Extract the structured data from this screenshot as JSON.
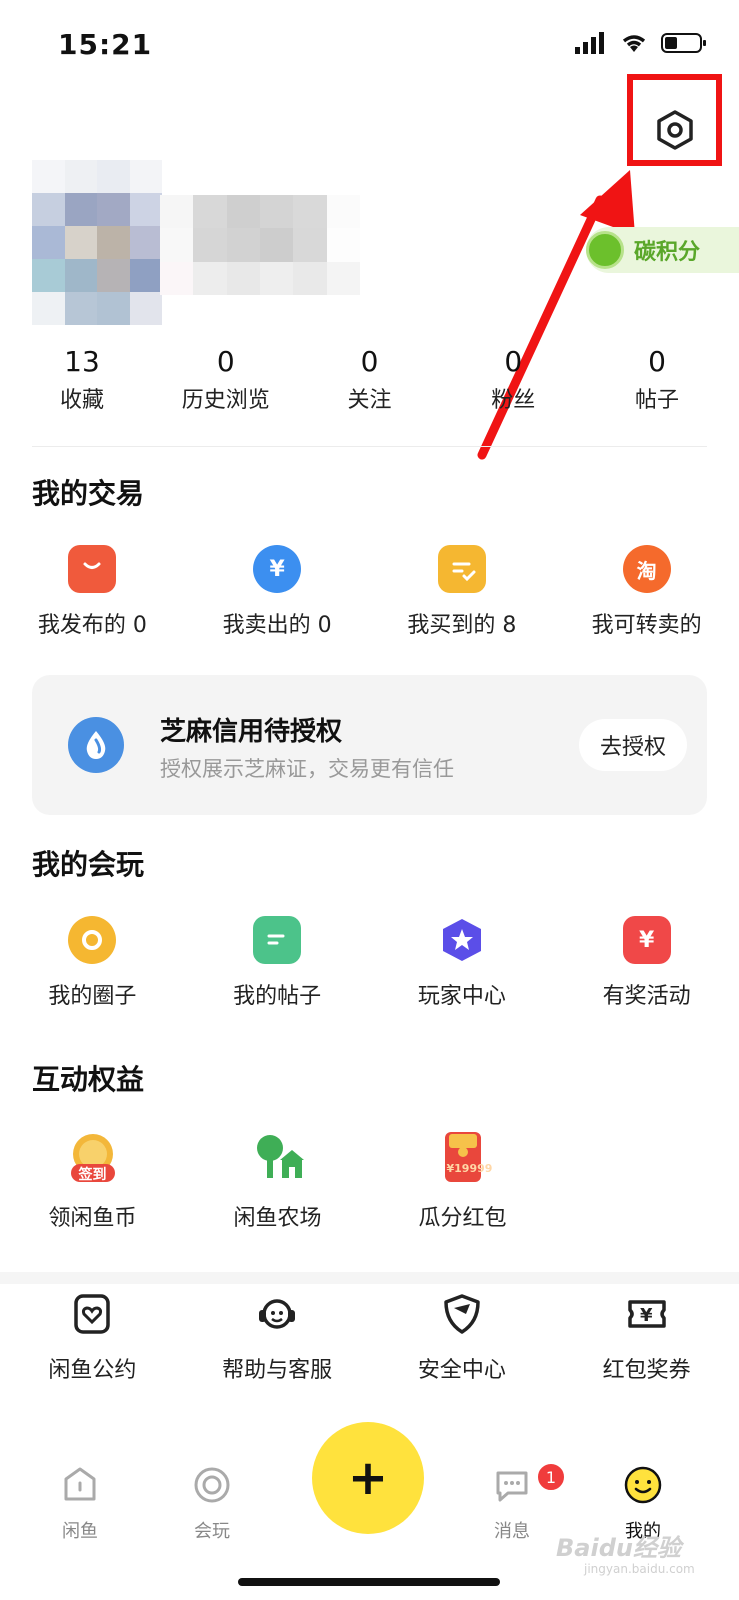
{
  "status_bar": {
    "time": "15:21"
  },
  "profile": {
    "carbon_label": "碳积分"
  },
  "stats": [
    {
      "value": "13",
      "label": "收藏"
    },
    {
      "value": "0",
      "label": "历史浏览"
    },
    {
      "value": "0",
      "label": "关注"
    },
    {
      "value": "0",
      "label": "粉丝"
    },
    {
      "value": "0",
      "label": "帖子"
    }
  ],
  "trade": {
    "title": "我的交易",
    "items": [
      {
        "label": "我发布的 0",
        "icon": "shopping-bag-icon"
      },
      {
        "label": "我卖出的 0",
        "icon": "yen-circle-icon"
      },
      {
        "label": "我买到的 8",
        "icon": "order-check-icon"
      },
      {
        "label": "我可转卖的",
        "icon": "taobao-icon",
        "glyph": "淘"
      }
    ]
  },
  "zhima": {
    "title": "芝麻信用待授权",
    "subtitle": "授权展示芝麻证，交易更有信任",
    "button": "去授权"
  },
  "play": {
    "title": "我的会玩",
    "items": [
      {
        "label": "我的圈子",
        "icon": "circle-icon"
      },
      {
        "label": "我的帖子",
        "icon": "post-icon"
      },
      {
        "label": "玩家中心",
        "icon": "star-hexagon-icon"
      },
      {
        "label": "有奖活动",
        "icon": "prize-yen-icon"
      }
    ]
  },
  "rights": {
    "title": "互动权益",
    "items": [
      {
        "label": "领闲鱼币",
        "icon": "checkin-coin-icon",
        "badge": "签到"
      },
      {
        "label": "闲鱼农场",
        "icon": "farm-house-icon"
      },
      {
        "label": "瓜分红包",
        "icon": "red-packet-icon",
        "badge": "¥19999"
      }
    ]
  },
  "services": [
    {
      "label": "闲鱼公约",
      "icon": "heart-document-icon"
    },
    {
      "label": "帮助与客服",
      "icon": "headset-icon"
    },
    {
      "label": "安全中心",
      "icon": "shield-icon"
    },
    {
      "label": "红包奖券",
      "icon": "coupon-icon"
    }
  ],
  "tabbar": {
    "tabs": [
      {
        "label": "闲鱼",
        "icon": "home-icon"
      },
      {
        "label": "会玩",
        "icon": "play-circle-icon"
      },
      {
        "label": "消息",
        "icon": "message-icon"
      },
      {
        "label": "我的",
        "icon": "smile-icon"
      }
    ],
    "publish_label": "+",
    "message_badge": "1"
  },
  "watermark": {
    "text": "Baidu经验",
    "sub": "jingyan.baidu.com"
  },
  "colors": {
    "accent_yellow": "#ffe23d",
    "highlight_red": "#f01414",
    "carbon_green": "#5aa72a"
  }
}
